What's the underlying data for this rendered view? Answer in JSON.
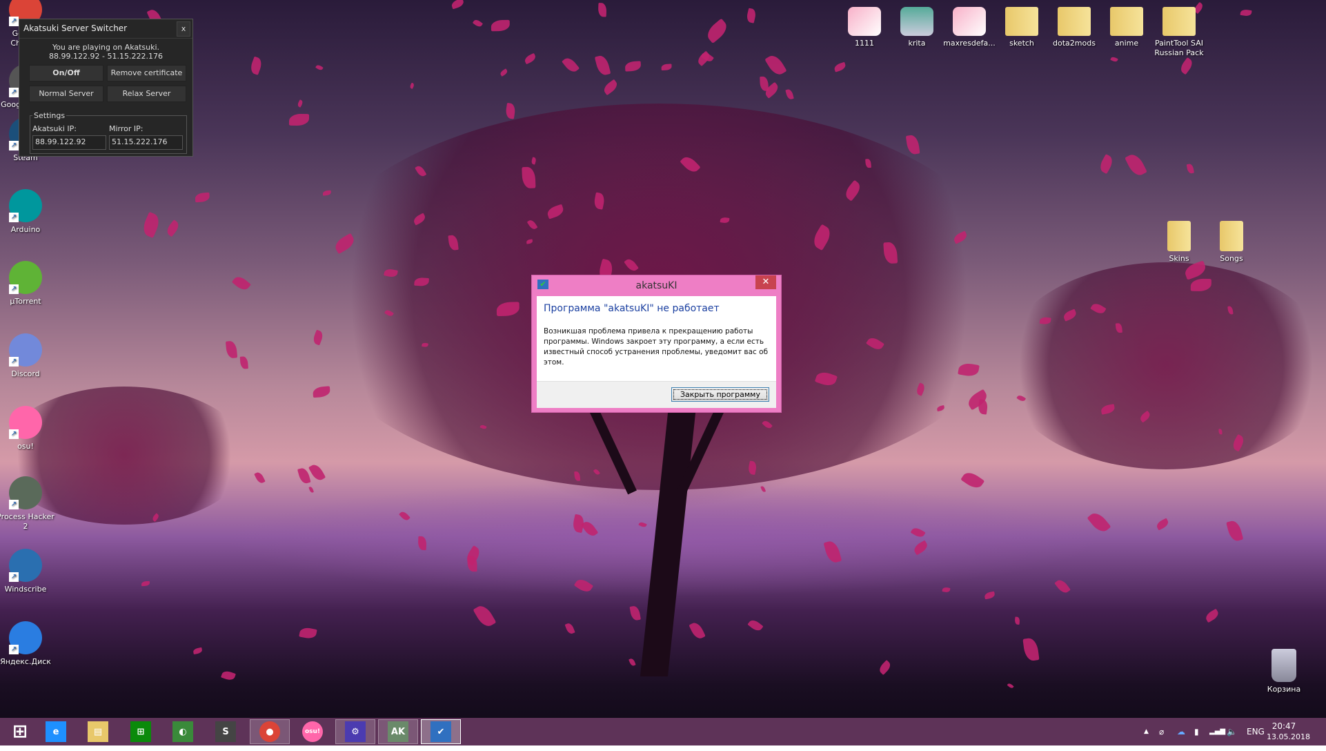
{
  "desktop_icons_left": [
    {
      "label": "Google Chrome",
      "color": "#db4437"
    },
    {
      "label": "Google Earth",
      "color": "#555"
    },
    {
      "label": "Steam",
      "color": "#1b4f7a"
    },
    {
      "label": "Arduino",
      "color": "#00979d"
    },
    {
      "label": "µTorrent",
      "color": "#5fb336"
    },
    {
      "label": "Discord",
      "color": "#7289da"
    },
    {
      "label": "osu!",
      "color": "#ff66aa"
    },
    {
      "label": "Process Hacker 2",
      "color": "#5a6a5a"
    },
    {
      "label": "Windscribe",
      "color": "#2a6fb0"
    },
    {
      "label": "Яндекс.Диск",
      "color": "#2a7de1"
    }
  ],
  "desktop_icons_top": [
    {
      "label": "1111",
      "type": "image"
    },
    {
      "label": "krita",
      "type": "file"
    },
    {
      "label": "maxresdefa...",
      "type": "image"
    },
    {
      "label": "sketch",
      "type": "folder"
    },
    {
      "label": "dota2mods",
      "type": "folder"
    },
    {
      "label": "anime",
      "type": "folder"
    },
    {
      "label": "PaintTool SAI Russian Pack",
      "type": "folder"
    }
  ],
  "desktop_icons_right": [
    {
      "label": "Skins",
      "type": "folder"
    },
    {
      "label": "Songs",
      "type": "folder"
    }
  ],
  "recycle_bin": {
    "label": "Корзина"
  },
  "switcher": {
    "title": "Akatsuki Server Switcher",
    "close": "x",
    "status_line1": "You are playing on Akatsuki.",
    "status_line2": "88.99.122.92 - 51.15.222.176",
    "on_off": "On/Off",
    "remove_cert": "Remove certificate",
    "normal_server": "Normal Server",
    "relax_server": "Relax Server",
    "settings_legend": "Settings",
    "akatsuki_ip_label": "Akatsuki IP:",
    "akatsuki_ip": "88.99.122.92",
    "mirror_ip_label": "Mirror IP:",
    "mirror_ip": "51.15.222.176"
  },
  "dialog": {
    "title": "akatsuKI",
    "close": "✕",
    "heading": "Программа \"akatsuKI\" не работает",
    "message": "Возникшая проблема привела к прекращению работы программы. Windows закроет эту программу, а если есть известный способ устранения проблемы, уведомит вас об этом.",
    "button": "Закрыть программу"
  },
  "taskbar": {
    "items": [
      {
        "name": "start",
        "glyph": "⊞",
        "bg": "transparent"
      },
      {
        "name": "internet-explorer",
        "glyph": "e",
        "bg": "#1e90ff"
      },
      {
        "name": "file-explorer",
        "glyph": "▤",
        "bg": "#e8c86a"
      },
      {
        "name": "store",
        "glyph": "⊞",
        "bg": "#0a8a0a"
      },
      {
        "name": "paint-tool",
        "glyph": "◐",
        "bg": "#3a8a3a"
      },
      {
        "name": "sublime-text",
        "glyph": "S",
        "bg": "#444"
      },
      {
        "name": "chrome",
        "glyph": "●",
        "bg": "#db4437"
      },
      {
        "name": "osu",
        "glyph": "osu!",
        "bg": "#ff66aa"
      },
      {
        "name": "settings",
        "glyph": "⚙",
        "bg": "#4b3bb0"
      },
      {
        "name": "akatsuki",
        "glyph": "AK",
        "bg": "#6a8a6a"
      },
      {
        "name": "error-reporting",
        "glyph": "✔",
        "bg": "#3070c0"
      }
    ],
    "language": "ENG",
    "time": "20:47",
    "date": "13.05.2018"
  }
}
